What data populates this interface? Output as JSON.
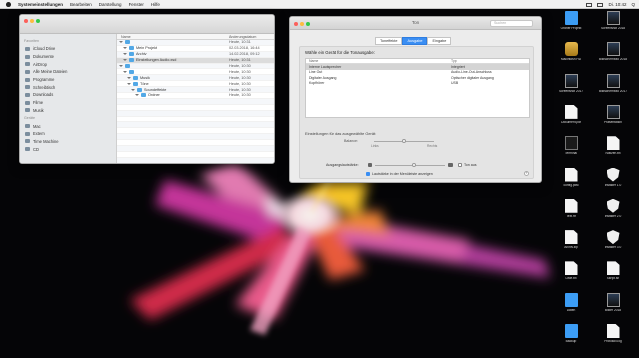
{
  "menubar": {
    "app": "Systemeinstellungen",
    "items": [
      "Bearbeiten",
      "Darstellung",
      "Fenster",
      "Hilfe"
    ],
    "right": [
      "Di. 10:42",
      "Q"
    ]
  },
  "finder": {
    "sidebar_heading_favorites": "Favoriten",
    "sidebar": [
      "iCloud Drive",
      "Dokumente",
      "AirDrop",
      "Alle Meine Dateien",
      "Programme",
      "Schreibtisch",
      "Downloads",
      "Filme",
      "Musik"
    ],
    "sidebar_heading_devices": "Geräte",
    "devices": [
      "Mac",
      "Extern",
      "Time Machine",
      "CD"
    ],
    "columns": [
      "Name",
      "Änderungsdatum"
    ],
    "rows": [
      {
        "name": "",
        "date": "Heute, 10:31"
      },
      {
        "name": "Mein Projekt",
        "date": "02.03.2018, 16:44"
      },
      {
        "name": "Archiv",
        "date": "14.02.2018, 09:12"
      },
      {
        "name": "Einstellungen Audio.xsd",
        "date": "Heute, 10:31"
      },
      {
        "name": "",
        "date": "Heute, 10:30"
      },
      {
        "name": "",
        "date": "Heute, 10:30"
      },
      {
        "name": "Musik",
        "date": "Heute, 10:30"
      },
      {
        "name": "Töne",
        "date": "Heute, 10:30"
      },
      {
        "name": "Soundeffekte",
        "date": "Heute, 10:30"
      },
      {
        "name": "Ordner",
        "date": "Heute, 10:30"
      },
      {
        "name": "",
        "date": ""
      },
      {
        "name": "",
        "date": ""
      },
      {
        "name": "",
        "date": ""
      },
      {
        "name": "",
        "date": ""
      },
      {
        "name": "",
        "date": ""
      },
      {
        "name": "",
        "date": ""
      },
      {
        "name": "",
        "date": ""
      },
      {
        "name": "",
        "date": ""
      },
      {
        "name": "",
        "date": ""
      },
      {
        "name": "",
        "date": ""
      },
      {
        "name": "",
        "date": ""
      },
      {
        "name": "",
        "date": ""
      }
    ]
  },
  "prefs": {
    "title": "Ton",
    "search_placeholder": "Suchen",
    "tabs": [
      "Toneffekte",
      "Ausgabe",
      "Eingabe"
    ],
    "active_tab": 1,
    "panel_title": "Wähle ein Gerät für die Tonausgabe:",
    "table_headers": [
      "Name",
      "Typ"
    ],
    "devices": [
      {
        "name": "Interne Lautsprecher",
        "type": "Integriert"
      },
      {
        "name": "Line Out",
        "type": "Audio-Line-Out-Anschluss"
      },
      {
        "name": "Digitaler Ausgang",
        "type": "Optischer digitaler Ausgang"
      },
      {
        "name": "Kopfhörer",
        "type": "USB"
      }
    ],
    "settings_label": "Einstellungen für das ausgewählte Gerät:",
    "balance_label": "Balance:",
    "balance_left": "Links",
    "balance_right": "Rechts",
    "balance": 0.5,
    "volume_label": "Ausgangslautstärke:",
    "volume": 0.55,
    "mute_label": "Ton aus",
    "menubar_check_label": "Lautstärke in der Menüleiste anzeigen",
    "help": "?"
  },
  "desktop_icons": [
    {
      "label": "Ordner Projekt",
      "kind": "folder"
    },
    {
      "label": "Screenshot 2018",
      "kind": "screen"
    },
    {
      "label": "Macintosh HD",
      "kind": "disk"
    },
    {
      "label": "Bildschirmfoto 2018",
      "kind": "screen"
    },
    {
      "label": "Screenshot 2017",
      "kind": "screen"
    },
    {
      "label": "Bildschirmfoto 2017",
      "kind": "screen"
    },
    {
      "label": "Dokument.pdf",
      "kind": "docw"
    },
    {
      "label": "Präsentation",
      "kind": "screen"
    },
    {
      "label": "Terminal",
      "kind": "dark"
    },
    {
      "label": "Notizen.txt",
      "kind": "docw"
    },
    {
      "label": "config.plist",
      "kind": "docw"
    },
    {
      "label": "Installer 1.0",
      "kind": "shield"
    },
    {
      "label": "Text.rtf",
      "kind": "docw"
    },
    {
      "label": "Installer 2.0",
      "kind": "shield"
    },
    {
      "label": "Archiv.zip",
      "kind": "docw"
    },
    {
      "label": "Installer 3.0",
      "kind": "shield"
    },
    {
      "label": "Liste.txt",
      "kind": "docw"
    },
    {
      "label": "Skript.sh",
      "kind": "docw"
    },
    {
      "label": "Daten",
      "kind": "folder"
    },
    {
      "label": "Bilder 2018",
      "kind": "screen"
    },
    {
      "label": "Backup",
      "kind": "folder"
    },
    {
      "label": "Protokoll.log",
      "kind": "docw"
    }
  ]
}
